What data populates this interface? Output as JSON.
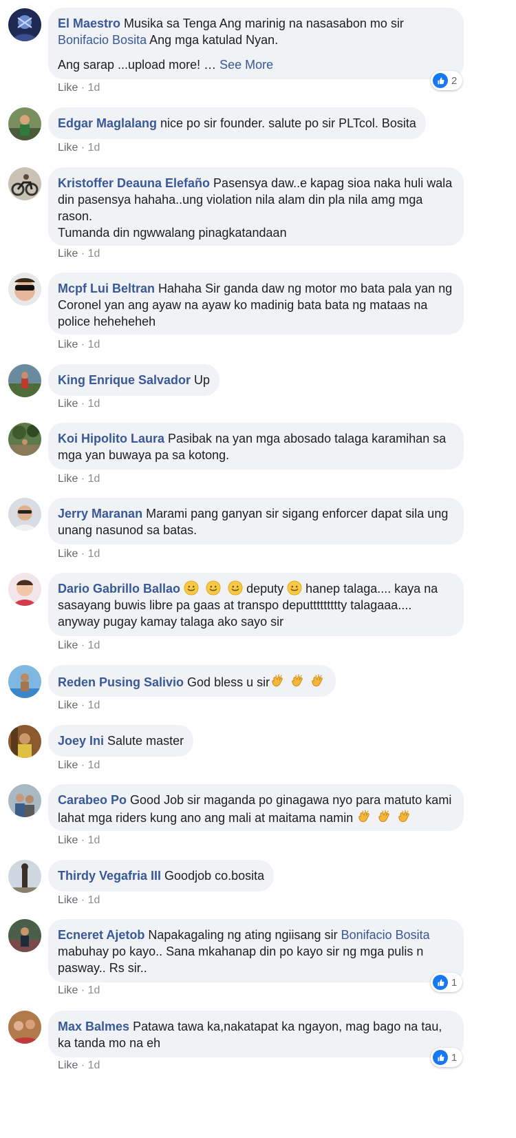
{
  "comments": [
    {
      "author": "El Maestro",
      "text_before": " Musika sa Tenga Ang marinig na nasasabon mo sir ",
      "mention": "Bonifacio Bosita",
      "text_after": " Ang mga katulad Nyan.",
      "text_line2": "Ang sarap ...upload more! … ",
      "see_more": "See More",
      "like": "Like",
      "time": "1d",
      "reactions": "2"
    },
    {
      "author": "Edgar Maglalang",
      "text": " nice po sir founder. salute po sir PLTcol. Bosita",
      "like": "Like",
      "time": "1d"
    },
    {
      "author": "Kristoffer Deauna Elefaño",
      "text": " Pasensya daw..e kapag sioa naka huli wala din pasensya hahaha..ung violation nila alam din pla nila amg mga rason.\nTumanda din ngwwalang pinagkatandaan",
      "like": "Like",
      "time": "1d"
    },
    {
      "author": "Mcpf Lui Beltran",
      "text": " Hahaha Sir ganda daw ng motor mo bata pala yan ng Coronel yan ang ayaw na ayaw ko madinig bata bata ng mataas na police heheheheh",
      "like": "Like",
      "time": "1d"
    },
    {
      "author": "King Enrique Salvador",
      "text": " Up",
      "like": "Like",
      "time": "1d"
    },
    {
      "author": "Koi Hipolito Laura",
      "text": " Pasibak na yan mga abosado talaga karamihan sa mga yan buwaya pa sa kotong.",
      "like": "Like",
      "time": "1d"
    },
    {
      "author": "Jerry Maranan",
      "text": " Marami pang ganyan sir sigang enforcer dapat sila ung unang nasunod sa batas.",
      "like": "Like",
      "time": "1d"
    },
    {
      "author": "Dario Gabrillo Ballao",
      "text_a": " ",
      "text_b": " deputy ",
      "text_c": " hanep talaga.... kaya na sasayang buwis libre pa gaas at transpo deputtttttttty talagaaa.... anyway pugay kamay talaga ako sayo sir",
      "like": "Like",
      "time": "1d"
    },
    {
      "author": "Reden Pusing Salivio",
      "text": " God bless u sir",
      "like": "Like",
      "time": "1d"
    },
    {
      "author": "Joey Ini",
      "text": " Salute master",
      "like": "Like",
      "time": "1d"
    },
    {
      "author": "Carabeo Po",
      "text": " Good Job sir maganda po ginagawa nyo para matuto kami lahat mga riders kung ano ang mali at maitama namin ",
      "like": "Like",
      "time": "1d"
    },
    {
      "author": "Thirdy Vegafria III",
      "text": " Goodjob co.bosita",
      "like": "Like",
      "time": "1d"
    },
    {
      "author": "Ecneret Ajetob",
      "text_before": " Napakagaling ng ating ngiisang sir ",
      "mention": "Bonifacio Bosita",
      "text_after": " mabuhay po kayo.. Sana mkahanap din po kayo sir ng mga pulis n pasway.. Rs sir..",
      "like": "Like",
      "time": "1d",
      "reactions": "1"
    },
    {
      "author": "Max Balmes",
      "text": " Patawa tawa ka,nakatapat ka ngayon, mag bago na tau, ka tanda mo na eh",
      "like": "Like",
      "time": "1d",
      "reactions": "1"
    }
  ],
  "meta_separator": " · ",
  "colors": {
    "link": "#385898",
    "bubble": "#f0f2f5",
    "like_blue": "#1877f2",
    "meta": "#65676b"
  }
}
